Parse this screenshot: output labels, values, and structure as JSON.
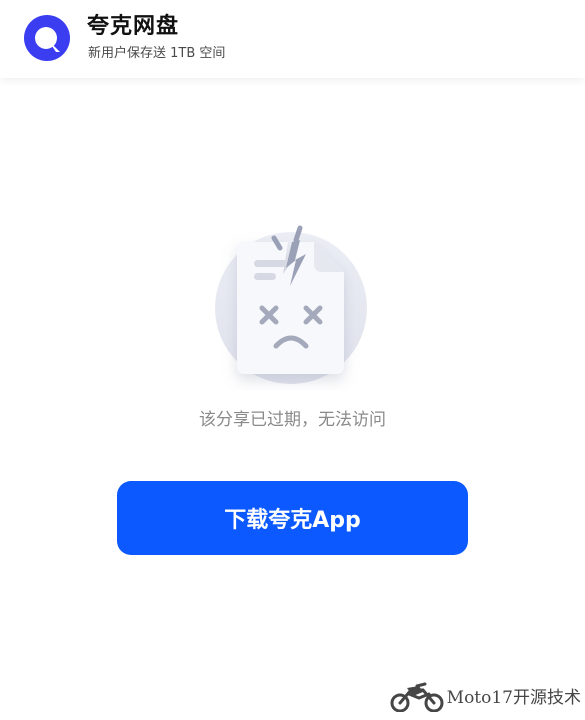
{
  "header": {
    "app_name": "夸克网盘",
    "tagline": "新用户保存送 1TB 空间",
    "logo_icon": "quark-logo-icon"
  },
  "main": {
    "illustration_icon": "broken-file-sad-face-icon",
    "message": "该分享已过期，无法访问",
    "download_button_label": "下载夸克App"
  },
  "watermark": {
    "text": "Moto17开源技术",
    "icon": "motorcycle-icon"
  },
  "colors": {
    "brand_blue": "#0c59ff",
    "logo_purple": "#3a3df0",
    "message_gray": "#8a8a8a"
  }
}
